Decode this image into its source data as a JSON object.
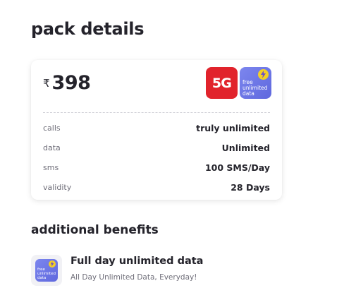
{
  "pack": {
    "heading": "pack details",
    "currency": "₹",
    "price": "398",
    "badge_5g": "5G",
    "badge_data_lines": [
      "free",
      "unlimited",
      "data"
    ],
    "details": [
      {
        "label": "calls",
        "value": "truly unlimited"
      },
      {
        "label": "data",
        "value": "Unlimited"
      },
      {
        "label": "sms",
        "value": "100 SMS/Day"
      },
      {
        "label": "validity",
        "value": "28 Days"
      }
    ]
  },
  "benefits": {
    "heading": "additional benefits",
    "items": [
      {
        "icon_lines": [
          "free",
          "unlimited",
          "data"
        ],
        "title": "Full day unlimited data",
        "description": "All Day Unlimited Data, Everyday!"
      }
    ]
  },
  "colors": {
    "text_primary": "#24232b",
    "text_secondary": "#6e6d78",
    "badge_5g": "#e1232c",
    "badge_data": "#6b74e6",
    "bolt": "#f3cf27"
  }
}
